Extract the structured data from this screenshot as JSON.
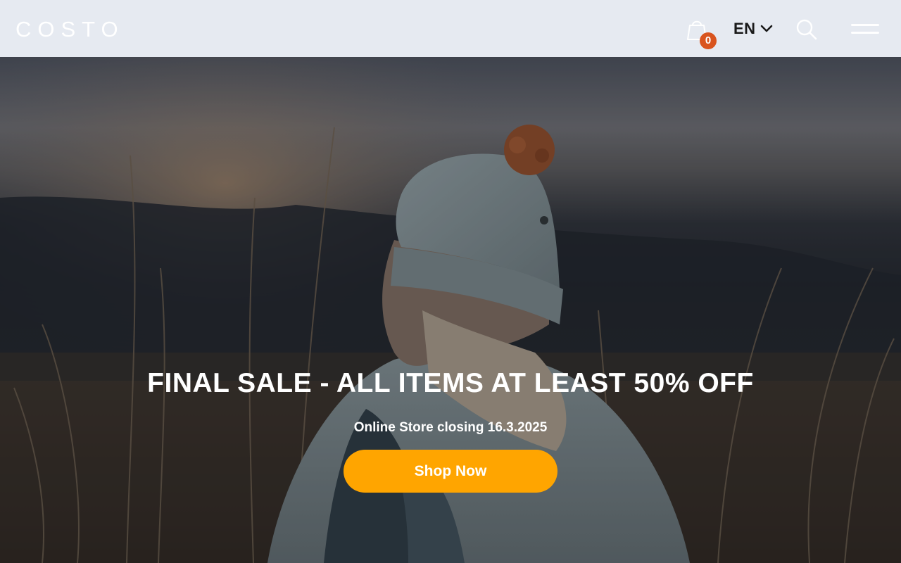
{
  "header": {
    "logo_text": "COSTO",
    "cart_count": "0",
    "language": "EN",
    "icons": {
      "cart": "shopping-bag-icon",
      "language_toggle": "chevron-down-icon",
      "search": "search-icon",
      "menu": "hamburger-menu-icon"
    }
  },
  "hero": {
    "title": "FINAL SALE - ALL ITEMS AT LEAST 50% OFF",
    "subtitle": "Online Store closing 16.3.2025",
    "cta_label": "Shop Now"
  },
  "colors": {
    "header_bg": "#e6eaf1",
    "accent": "#ffa500",
    "badge": "#d9541e"
  }
}
